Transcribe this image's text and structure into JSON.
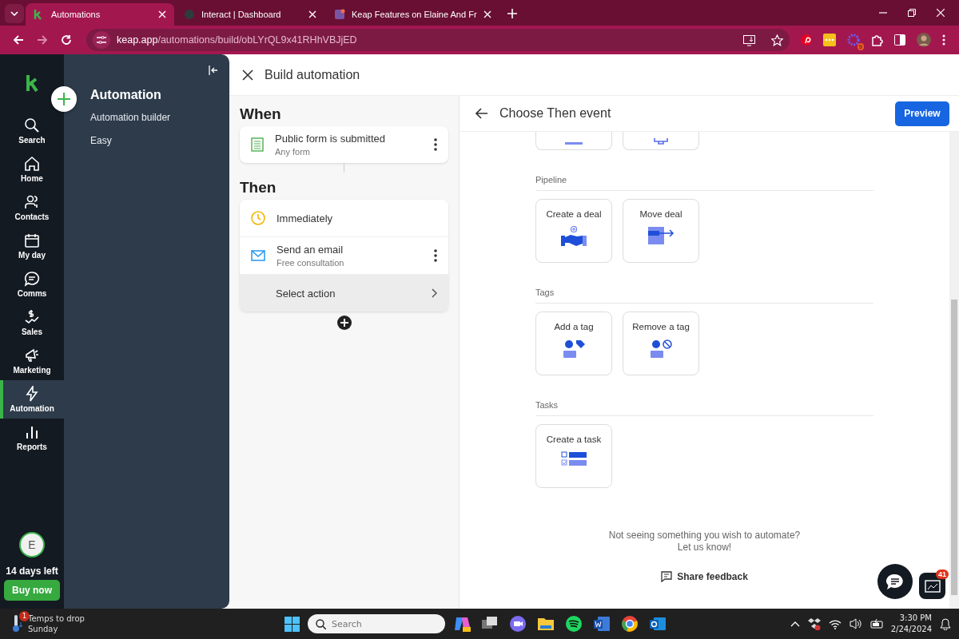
{
  "browser": {
    "tabs": [
      {
        "title": "Automations",
        "selected": true
      },
      {
        "title": "Interact | Dashboard",
        "selected": false
      },
      {
        "title": "Keap Features on Elaine And Fr",
        "selected": false
      }
    ],
    "url_host": "keap.app",
    "url_path": "/automations/build/obLYrQL9x41RHhVBJjED",
    "extension_badge": "9"
  },
  "rail": {
    "items": [
      {
        "label": "Search",
        "selected": false
      },
      {
        "label": "Home",
        "selected": false
      },
      {
        "label": "Contacts",
        "selected": false
      },
      {
        "label": "My day",
        "selected": false
      },
      {
        "label": "Comms",
        "selected": false
      },
      {
        "label": "Sales",
        "selected": false
      },
      {
        "label": "Marketing",
        "selected": false
      },
      {
        "label": "Automation",
        "selected": true
      },
      {
        "label": "Reports",
        "selected": false
      }
    ],
    "avatar": "E",
    "trial": "14 days left",
    "buy_button": "Buy now"
  },
  "submenu": {
    "title": "Automation",
    "items": [
      "Automation builder",
      "Easy"
    ]
  },
  "builder": {
    "title": "Build automation",
    "when": {
      "heading": "When",
      "title": "Public form is submitted",
      "subtitle": "Any form"
    },
    "then": {
      "heading": "Then",
      "steps": [
        {
          "kind": "delay",
          "title": "Immediately"
        },
        {
          "kind": "action",
          "title": "Send an email",
          "subtitle": "Free consultation"
        },
        {
          "kind": "placeholder",
          "title": "Select action"
        }
      ]
    }
  },
  "panel": {
    "title": "Choose Then event",
    "preview_button": "Preview",
    "sections": [
      {
        "heading": "Pipeline",
        "actions": [
          "Create a deal",
          "Move deal"
        ]
      },
      {
        "heading": "Tags",
        "actions": [
          "Add a tag",
          "Remove a tag"
        ]
      },
      {
        "heading": "Tasks",
        "actions": [
          "Create a task"
        ]
      }
    ],
    "feedback_text": "Not seeing something you wish to automate?",
    "feedback_text_2": "Let us know!",
    "share_feedback": "Share feedback",
    "notification_badge": "41"
  },
  "taskbar": {
    "weather_title": "Temps to drop",
    "weather_subtitle": "Sunday",
    "weather_badge": "1",
    "search_placeholder": "Search",
    "time": "3:30 PM",
    "date": "2/24/2024"
  }
}
